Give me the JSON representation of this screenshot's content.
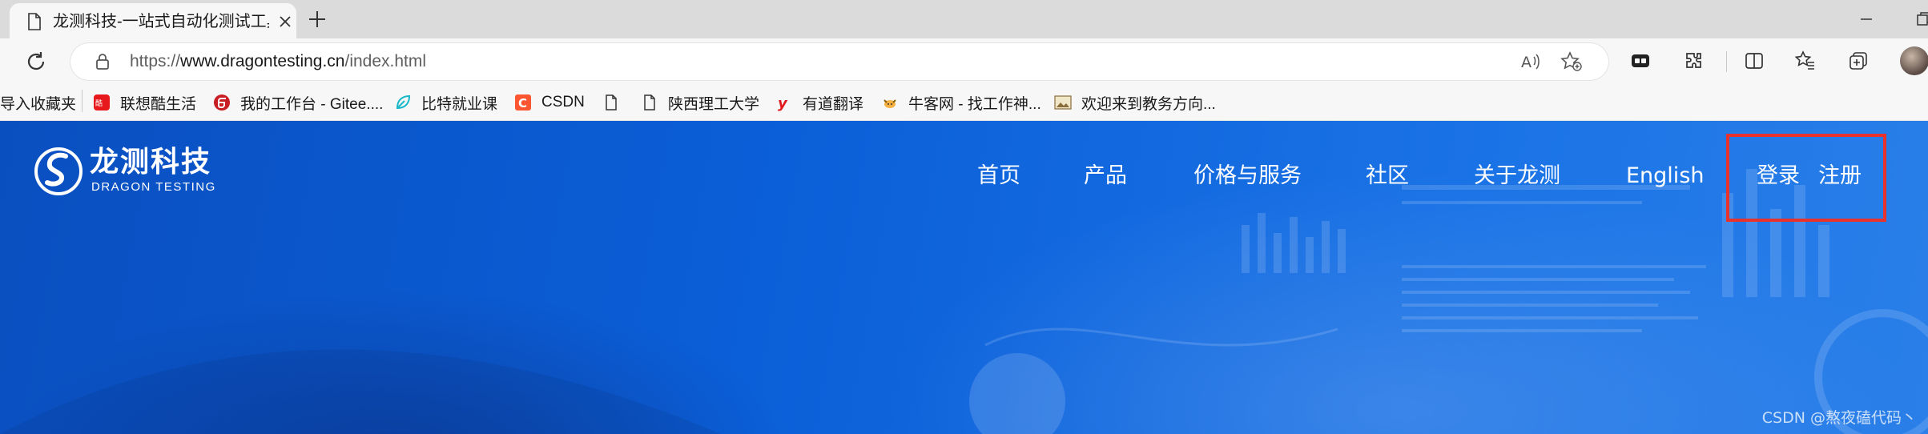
{
  "browser": {
    "tab_title": "龙测科技-一站式自动化测试工具",
    "url_scheme": "https://",
    "url_domain": "www.dragontesting.cn",
    "url_path": "/index.html"
  },
  "bookmarks": [
    {
      "label": "导入收藏夹",
      "icon": "none"
    },
    {
      "label": "联想酷生活",
      "icon": "lenovo-icon"
    },
    {
      "label": "我的工作台 - Gitee....",
      "icon": "gitee-icon"
    },
    {
      "label": "比特就业课",
      "icon": "leaf-icon"
    },
    {
      "label": "CSDN",
      "icon": "csdn-icon"
    },
    {
      "label": "",
      "icon": "page-icon"
    },
    {
      "label": "陕西理工大学",
      "icon": "page-icon"
    },
    {
      "label": "有道翻译",
      "icon": "youdao-icon"
    },
    {
      "label": "牛客网 - 找工作神...",
      "icon": "nowcoder-icon"
    },
    {
      "label": "欢迎来到教务方向...",
      "icon": "image-icon"
    }
  ],
  "site": {
    "logo_cn": "龙测科技",
    "logo_en": "DRAGON TESTING",
    "nav": {
      "home": "首页",
      "products": "产品",
      "pricing": "价格与服务",
      "community": "社区",
      "about": "关于龙测",
      "english": "English",
      "login": "登录",
      "register": "注册"
    },
    "watermark": "CSDN @熬夜磕代码丶",
    "highlight_color": "#e8322e",
    "hero_color": "#0b5fd8"
  }
}
